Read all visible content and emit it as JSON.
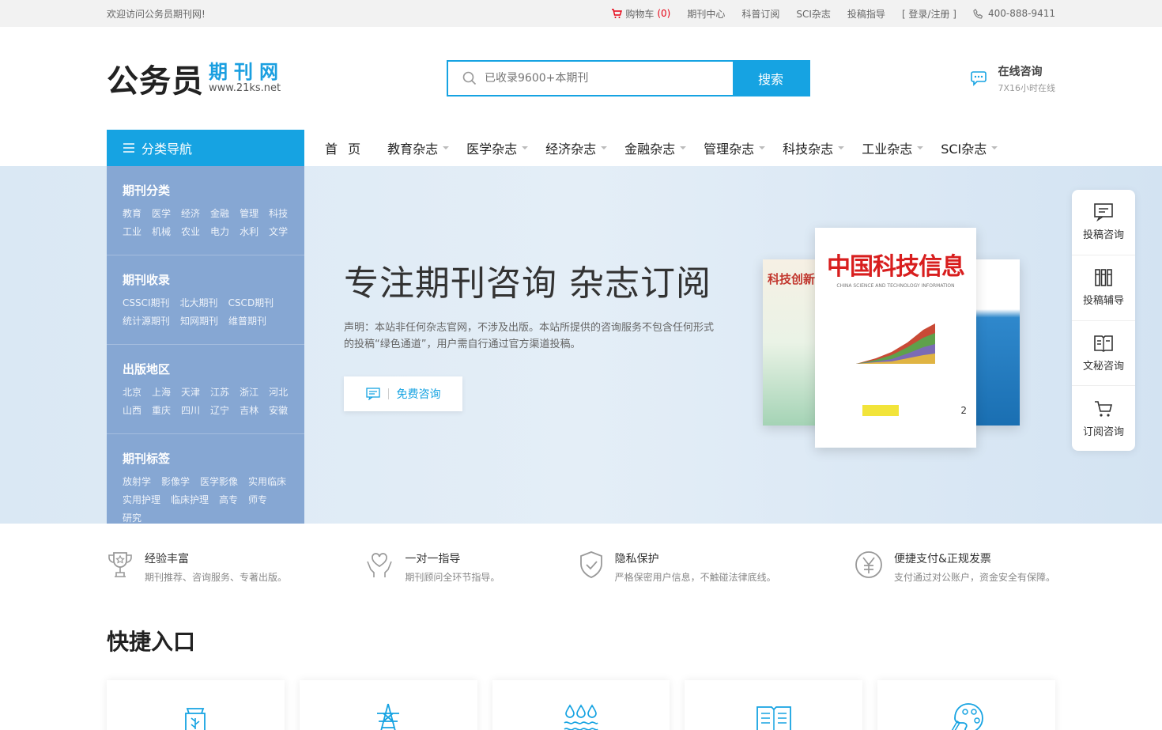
{
  "topbar": {
    "welcome": "欢迎访问公务员期刊网!",
    "cart_label": "购物车",
    "cart_count": "(0)",
    "links": [
      "期刊中心",
      "科普订阅",
      "SCI杂志",
      "投稿指导",
      "[ 登录/注册 ]"
    ],
    "phone": "400-888-9411"
  },
  "header": {
    "logo_main": "公务员",
    "logo_qk": "期刊网",
    "logo_url": "www.21ks.net",
    "search_placeholder": "已收录9600+本期刊",
    "search_button": "搜索",
    "consult_title": "在线咨询",
    "consult_sub": "7X16小时在线"
  },
  "nav": {
    "category_label": "分类导航",
    "items": [
      "首 页",
      "教育杂志",
      "医学杂志",
      "经济杂志",
      "金融杂志",
      "管理杂志",
      "科技杂志",
      "工业杂志",
      "SCI杂志"
    ]
  },
  "sidemenu": [
    {
      "title": "期刊分类",
      "links": [
        "教育",
        "医学",
        "经济",
        "金融",
        "管理",
        "科技",
        "工业",
        "机械",
        "农业",
        "电力",
        "水利",
        "文学"
      ]
    },
    {
      "title": "期刊收录",
      "links": [
        "CSSCI期刊",
        "北大期刊",
        "CSCD期刊",
        "统计源期刊",
        "知网期刊",
        "维普期刊"
      ]
    },
    {
      "title": "出版地区",
      "links": [
        "北京",
        "上海",
        "天津",
        "江苏",
        "浙江",
        "河北",
        "山西",
        "重庆",
        "四川",
        "辽宁",
        "吉林",
        "安徽"
      ]
    },
    {
      "title": "期刊标签",
      "links": [
        "放射学",
        "影像学",
        "医学影像",
        "实用临床",
        "实用护理",
        "临床护理",
        "高专",
        "师专",
        "研究"
      ]
    }
  ],
  "banner": {
    "slogan": "专注期刊咨询  杂志订阅",
    "notice": "声明：本站非任何杂志官网，不涉及出版。本站所提供的咨询服务不包含任何形式的投稿“绿色通道”，用户需自行通过官方渠道投稿。",
    "free_button": "免费咨询",
    "cover_main_title": "中国科技信息",
    "cover_main_sub": "CHINA SCIENCE AND TECHNOLOGY INFORMATION",
    "cover_issue": "2",
    "cover_left_title": "科技创新"
  },
  "float_menu": [
    {
      "label": "投稿咨询",
      "icon": "chat-box-icon"
    },
    {
      "label": "投稿辅导",
      "icon": "books-icon"
    },
    {
      "label": "文秘咨询",
      "icon": "open-book-icon"
    },
    {
      "label": "订阅咨询",
      "icon": "cart-icon"
    }
  ],
  "features": [
    {
      "title": "经验丰富",
      "desc": "期刊推荐、咨询服务、专著出版。",
      "icon": "trophy-icon"
    },
    {
      "title": "一对一指导",
      "desc": "期刊顾问全环节指导。",
      "icon": "heart-hands-icon"
    },
    {
      "title": "隐私保护",
      "desc": "严格保密用户信息，不触碰法律底线。",
      "icon": "shield-icon"
    },
    {
      "title": "便捷支付&正规发票",
      "desc": "支付通过对公账户，资金安全有保障。",
      "icon": "yen-icon"
    }
  ],
  "quick": {
    "title": "快捷入口",
    "tiles": [
      "agriculture-icon",
      "power-tower-icon",
      "water-icon",
      "book-icon",
      "art-palette-icon"
    ]
  },
  "colors": {
    "accent": "#16a3e2",
    "sidemenu": "#86a7d3",
    "cart_count": "#e60012"
  }
}
